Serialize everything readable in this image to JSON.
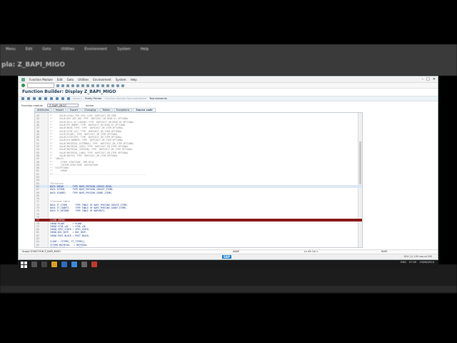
{
  "background": {
    "menu": [
      "Menu",
      "Edit",
      "Goto",
      "Utilities",
      "Environment",
      "System",
      "Help"
    ],
    "title": "pla: Z_BAPI_MIGO"
  },
  "window": {
    "menu": [
      "Function Module",
      "Edit",
      "Goto",
      "Utilities",
      "Environment",
      "System",
      "Help"
    ],
    "title": "Function Builder: Display Z_BAPI_MIGO",
    "toolbar": {
      "pattern": "Pattern",
      "pretty_printer": "Pretty Printer",
      "fm_documentation": "Function Module Documentation",
      "test_elements": "Test elements"
    },
    "function_module_label": "Function module",
    "function_module_value": "Z_BAPI_MIGO",
    "status": "Active",
    "tabs": [
      "Attributes",
      "Import",
      "Export",
      "Changing",
      "Tables",
      "Exceptions",
      "Source code"
    ],
    "active_tab": "Source code",
    "editor_lines": [
      {
        "n": "43",
        "t": "*\"     VALUE(LEGAL_FOR_STO) LIKE  BAPI2017_GM_CODE",
        "k": "com"
      },
      {
        "n": "44",
        "t": "*\"     VALUE(REF_DOC_NO) TYPE  BAPI2017_GM_HEAD_01 OPTIONAL",
        "k": "com"
      },
      {
        "n": "45",
        "t": "*\"     VALUE(BILL_OF_LADING) TYPE  BAPI2017_GM_HEAD_01 OPTIONAL",
        "k": "com"
      },
      {
        "n": "46",
        "t": "*\"     VALUE(PR_UNAME) TYPE  BAPI2017_GM_HEAD_01 OPTIONAL",
        "k": "com"
      },
      {
        "n": "47",
        "t": "*\"     VALUE(MOVE_TYPE) TYPE  BAPI2017_GM_ITEM OPTIONAL",
        "k": "com"
      },
      {
        "n": "48",
        "t": "*\"     VALUE(STGE_LOC) TYPE  BAPI2017_GM_ITEM OPTIONAL",
        "k": "com"
      },
      {
        "n": "49",
        "t": "*\"     VALUE(PLANT) TYPE  BAPI2017_GM_ITEM OPTIONAL",
        "k": "com"
      },
      {
        "n": "50",
        "t": "*\"     VALUE(STCKTYPE) TYPE  BAPI2017_GM_ITEM OPTIONAL",
        "k": "com"
      },
      {
        "n": "51",
        "t": "*\"     VALUE(PO_NUMBER) TYPE  BAPI2017_GM_ITEM OPTIONAL",
        "k": "com"
      },
      {
        "n": "52",
        "t": "*\"     VALUE(MATERIAL_EXTERNAL) TYPE  BAPI2017_GM_ITEM OPTIONAL",
        "k": "com"
      },
      {
        "n": "53",
        "t": "*\"     VALUE(MATERIAL_GUID) TYPE  BAPI2017_GM_ITEM OPTIONAL",
        "k": "com"
      },
      {
        "n": "54",
        "t": "*\"     VALUE(MATERIAL_VERSION) TYPE  BAPI2017_GM_ITEM OPTIONAL",
        "k": "com"
      },
      {
        "n": "55",
        "t": "*\"     VALUE(MATERIAL_LONG) TYPE  BAPI2017_GM_ITEM OPTIONAL",
        "k": "com"
      },
      {
        "n": "56",
        "t": "*\"     VALUE(BATCH) TYPE  BAPI2017_GM_ITEM OPTIONAL",
        "k": "com"
      },
      {
        "n": "57",
        "t": "*\"  TABLES",
        "k": "com"
      },
      {
        "n": "58",
        "t": "*\"      ITEMS STRUCTURE  ZMM_MIGO",
        "k": "com"
      },
      {
        "n": "59",
        "t": "*\"      CUSTOM_STRUCTURE  BAPIRETURN",
        "k": "com"
      },
      {
        "n": "60",
        "t": "*\"  EXCEPTIONS",
        "k": "com"
      },
      {
        "n": "61",
        "t": "*\"      ERROR",
        "k": "com"
      },
      {
        "n": "62",
        "t": "*\"----------------------------------------------------------------------",
        "k": "com"
      },
      {
        "n": "63",
        "t": "",
        "k": "code"
      },
      {
        "n": "64",
        "t": "",
        "k": "code"
      },
      {
        "n": "65",
        "t": "*Structure",
        "k": "com"
      },
      {
        "n": "66",
        "t": "DATA IHEAD       TYPE BAPI_PHYSINV_CREATE_HEAD.",
        "k": "code",
        "sel": true
      },
      {
        "n": "67",
        "t": "DATA IITEMS      TYPE BAPI_PHYSINV_CREATE_ITEMS.",
        "k": "code"
      },
      {
        "n": "68",
        "t": "DATA ICOUNTL     TYPE BAPI_PHYSINV_COUNT_ITEMS.",
        "k": "code"
      },
      {
        "n": "69",
        "t": "",
        "k": "code"
      },
      {
        "n": "70",
        "t": "",
        "k": "code"
      },
      {
        "n": "71",
        "t": "*Internal table",
        "k": "com"
      },
      {
        "n": "72",
        "t": "DATA IT_ITEMS      TYPE TABLE OF BAPI_PHYSINV_CREATE_ITEMS.",
        "k": "code"
      },
      {
        "n": "73",
        "t": "DATA IT_COUNTI     TYPE TABLE OF BAPI_PHYSINV_COUNT_ITEMS.",
        "k": "code"
      },
      {
        "n": "74",
        "t": "DATA IT_RETURN     TYPE TABLE OF BAPIRET2.",
        "k": "code"
      },
      {
        "n": "75",
        "t": "",
        "k": "code"
      },
      {
        "n": "76",
        "t": "",
        "k": "code"
      },
      {
        "n": "77",
        "t": "CLEAR IHEAD.",
        "k": "code",
        "hl": true
      },
      {
        "n": "78",
        "t": "IHEAD-PLANT      = PLANT.",
        "k": "code"
      },
      {
        "n": "79",
        "t": "IHEAD-STGE_LOC   = STGE_LOC.",
        "k": "code"
      },
      {
        "n": "80",
        "t": "IHEAD-SPEC_STOCK = SPEC_STOCK.",
        "k": "code"
      },
      {
        "n": "81",
        "t": "IHEAD-DOC_DATE   = DOC_DATE.",
        "k": "code"
      },
      {
        "n": "82",
        "t": "IHEAD-POST_BLOCK = POST_BLOCK.",
        "k": "code"
      },
      {
        "n": "83",
        "t": "",
        "k": "code"
      },
      {
        "n": "84",
        "t": "CLEAR : IITEMS, IT_ITEMS[].",
        "k": "code"
      },
      {
        "n": "85",
        "t": "IITEMS-MATERIAL   = MATERIAL.",
        "k": "code"
      },
      {
        "n": "86",
        "t": "IITEMS-BATCH      = BATCH.",
        "k": "code"
      },
      {
        "n": "87",
        "t": "IITEMS-STOCK_TYPE = STOCK_TYPE.",
        "k": "code"
      }
    ],
    "statusbar": {
      "left": "Scope \\FUNCTION Z_BAPI_MIGO",
      "mid": "ABAP",
      "right": "Ln 43 Col 1",
      "mode": "NUM"
    },
    "sap_logo": "SAP",
    "sap_footer_right": "DS4 (1) 100   sap-s4   INS"
  },
  "taskbar": {
    "tray_time": "07:50",
    "tray_date": "19/06/2024",
    "tray_lang": "ENG"
  }
}
